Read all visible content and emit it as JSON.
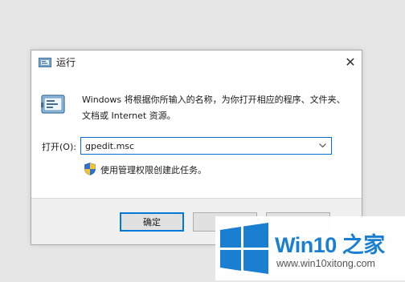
{
  "dialog": {
    "title": "运行",
    "close_glyph": "✕",
    "description": "Windows 将根据你所输入的名称，为你打开相应的程序、文件夹、文档或 Internet 资源。",
    "open_label": "打开(O):",
    "command_value": "gpedit.msc",
    "admin_note": "使用管理权限创建此任务。",
    "buttons": {
      "ok": "确定",
      "cancel": "",
      "browse": ""
    }
  },
  "watermark": {
    "title": "Win10 之家",
    "url": "www.win10xitong.com"
  },
  "colors": {
    "accent": "#0078d7",
    "logo_blue": "#1a7fd0",
    "background": "#e6e6e6",
    "footer": "#f0f0f0"
  },
  "icons": [
    "run-app-icon",
    "close-icon",
    "chevron-down-icon",
    "uac-shield-icon",
    "windows-logo-icon"
  ]
}
